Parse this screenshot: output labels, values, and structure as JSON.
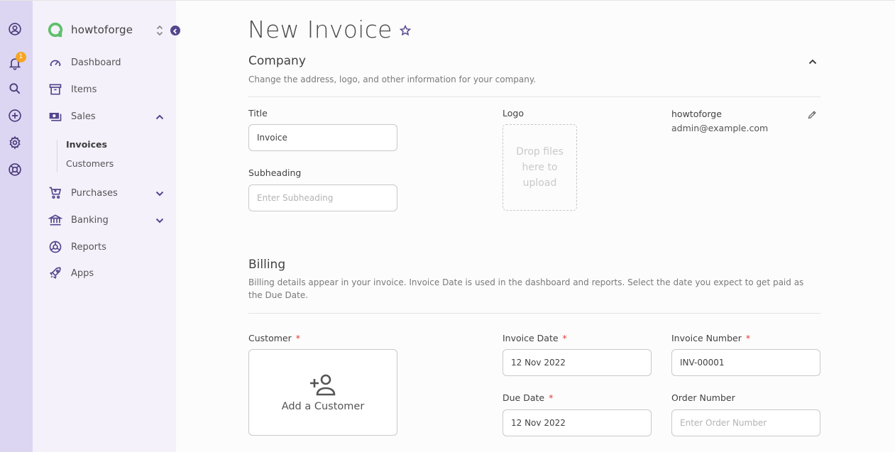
{
  "rail": {
    "notification_count": "1"
  },
  "sidebar": {
    "company_name": "howtoforge",
    "items": [
      {
        "label": "Dashboard"
      },
      {
        "label": "Items"
      },
      {
        "label": "Sales"
      },
      {
        "label": "Purchases"
      },
      {
        "label": "Banking"
      },
      {
        "label": "Reports"
      },
      {
        "label": "Apps"
      }
    ],
    "sales_sub": [
      {
        "label": "Invoices",
        "active": true
      },
      {
        "label": "Customers",
        "active": false
      }
    ]
  },
  "page": {
    "title": "New Invoice"
  },
  "company": {
    "section_title": "Company",
    "description": "Change the address, logo, and other information for your company.",
    "title_label": "Title",
    "title_value": "Invoice",
    "subheading_label": "Subheading",
    "subheading_placeholder": "Enter Subheading",
    "logo_label": "Logo",
    "dropzone_text": "Drop files here to upload",
    "name": "howtoforge",
    "email": "admin@example.com"
  },
  "billing": {
    "section_title": "Billing",
    "description": "Billing details appear in your invoice. Invoice Date is used in the dashboard and reports. Select the date you expect to get paid as the Due Date.",
    "customer_label": "Customer",
    "add_customer": "Add a Customer",
    "invoice_date_label": "Invoice Date",
    "invoice_date_value": "12 Nov 2022",
    "due_date_label": "Due Date",
    "due_date_value": "12 Nov 2022",
    "invoice_number_label": "Invoice Number",
    "invoice_number_value": "INV-00001",
    "order_number_label": "Order Number",
    "order_number_placeholder": "Enter Order Number",
    "required_mark": "*"
  },
  "colors": {
    "accent": "#55468d",
    "rail_bg": "#dcd6f2",
    "sidebar_bg": "#f4f1fb",
    "badge": "#f5a524",
    "required": "#e53935"
  }
}
